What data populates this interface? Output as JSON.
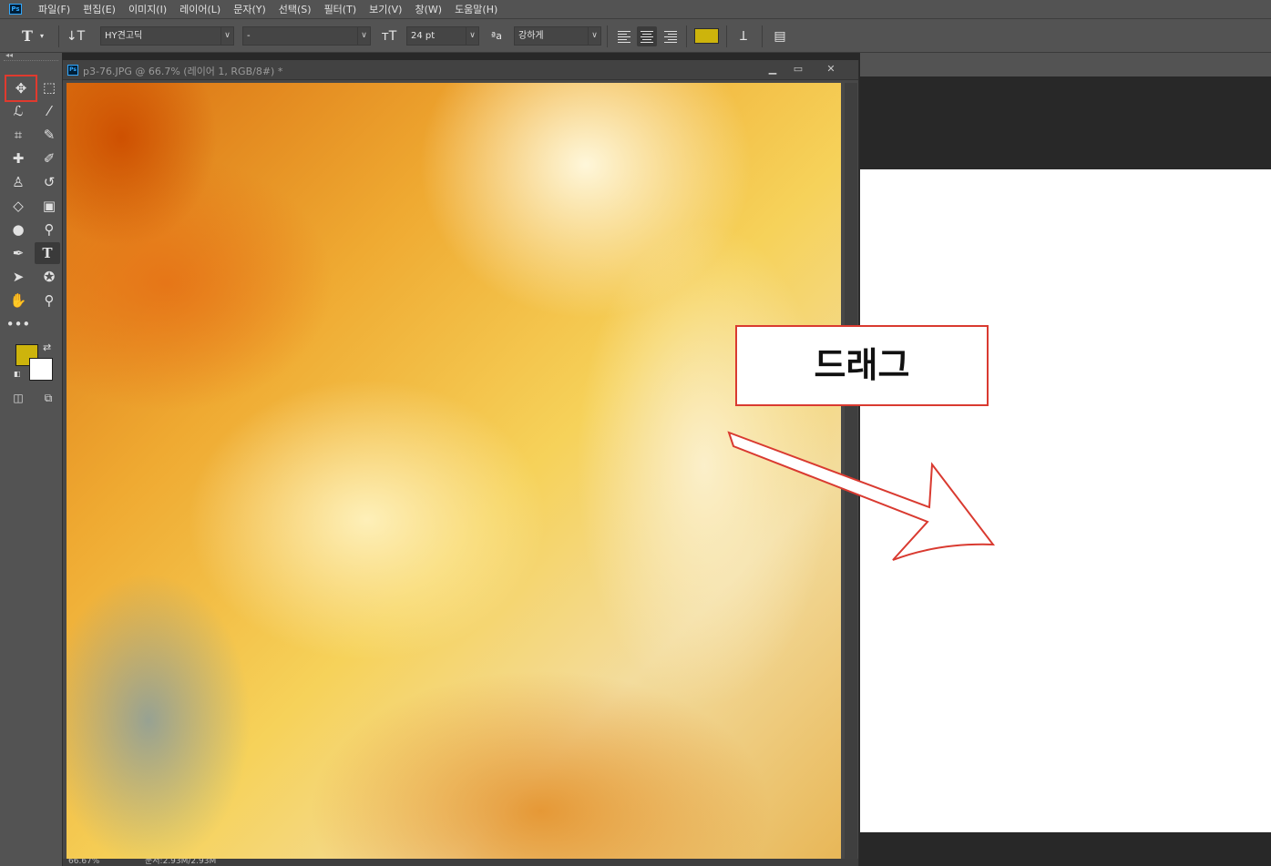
{
  "menu": [
    "파일(F)",
    "편집(E)",
    "이미지(I)",
    "레이어(L)",
    "문자(Y)",
    "선택(S)",
    "필터(T)",
    "보기(V)",
    "창(W)",
    "도움말(H)"
  ],
  "app_logo": "Ps",
  "options": {
    "font_family": "HY견고딕",
    "font_style": "-",
    "font_size": "24 pt",
    "antialias_icon_text": "ªa",
    "antialias": "강하게",
    "text_color": "#cdb40c"
  },
  "document": {
    "title": "p3-76.JPG @ 66.7% (레이어 1, RGB/8#) *",
    "zoom": "66.67%",
    "status": "문서:2.93M/2.93M"
  },
  "toolbox": {
    "foreground_color": "#cdb40c",
    "background_color": "#ffffff"
  },
  "annotation": {
    "label": "드래그",
    "border_color": "#d93a30"
  }
}
